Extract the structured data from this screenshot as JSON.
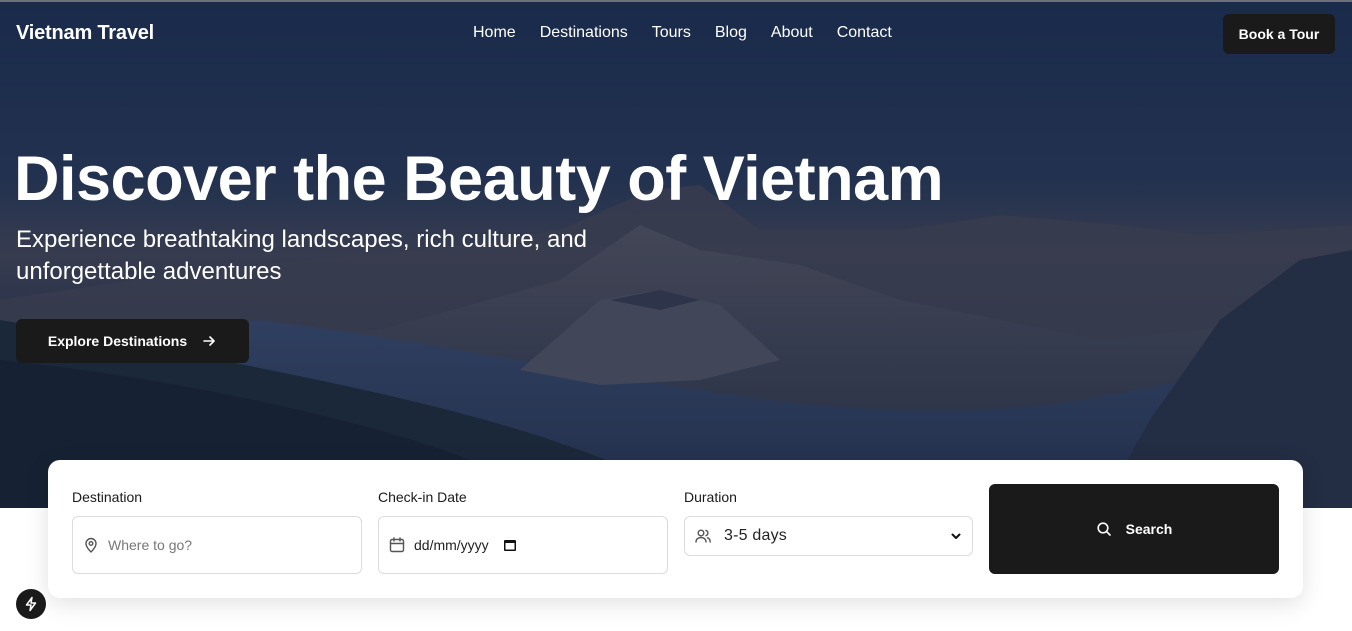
{
  "brand": "Vietnam Travel",
  "nav": {
    "items": [
      "Home",
      "Destinations",
      "Tours",
      "Blog",
      "About",
      "Contact"
    ],
    "cta": "Book a Tour"
  },
  "hero": {
    "title": "Discover the Beauty of Vietnam",
    "subtitle": "Experience breathtaking landscapes, rich culture, and unforgettable adventures",
    "button": "Explore Destinations"
  },
  "search": {
    "destination": {
      "label": "Destination",
      "placeholder": "Where to go?"
    },
    "checkin": {
      "label": "Check-in Date",
      "value": "dd/mm/yyyy"
    },
    "duration": {
      "label": "Duration",
      "selected": "3-5 days"
    },
    "button": "Search"
  },
  "icons": {
    "destination": "map-pin-icon",
    "checkin": "calendar-icon",
    "duration": "users-icon",
    "search": "search-icon",
    "explore": "arrow-right-icon",
    "fab": "lightning-icon"
  },
  "colors": {
    "dark_button": "#1a1a1a",
    "hero_overlay": "#1b2a48",
    "text_light": "#ffffff"
  }
}
